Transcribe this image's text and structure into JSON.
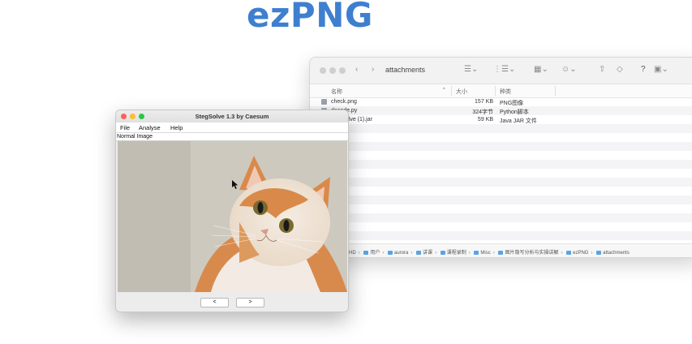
{
  "headline": "ezPNG",
  "finder": {
    "title": "attachments",
    "columns": {
      "name": "名称",
      "size": "大小",
      "kind": "种类"
    },
    "files": [
      {
        "name": "check.png",
        "size": "157 KB",
        "kind": "PNG图像"
      },
      {
        "name": "decode.py",
        "size": "324字节",
        "kind": "Python脚本"
      },
      {
        "name": "Stegsolve (1).jar",
        "size": "59 KB",
        "kind": "Java JAR 文件"
      }
    ],
    "path": [
      "HD",
      "用户",
      "aurora",
      "讲课",
      "课程录制",
      "Misc",
      "图片隐写分析与实操讲解",
      "ezPNG",
      "attachments"
    ]
  },
  "steg": {
    "title": "StegSolve 1.3 by Caesum",
    "menu": {
      "file": "File",
      "analyse": "Analyse",
      "help": "Help"
    },
    "image_label": "Normal Image",
    "prev": "<",
    "next": ">"
  },
  "colors": {
    "headline": "#3e7fd0",
    "folder": "#5aa3e6"
  }
}
